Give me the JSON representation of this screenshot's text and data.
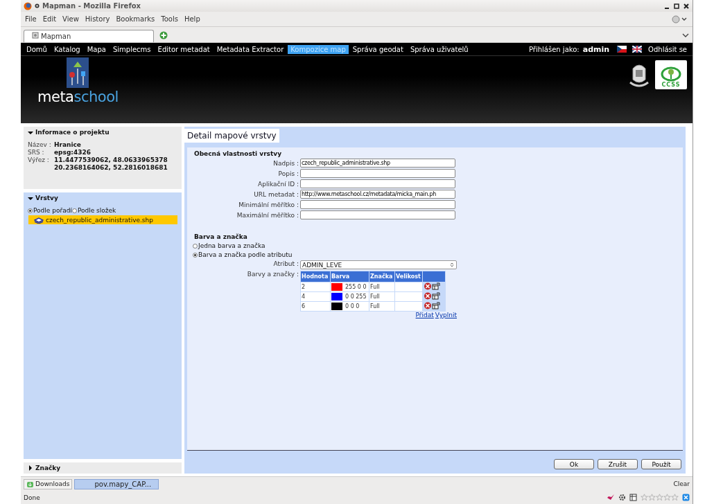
{
  "window": {
    "title": "Mapman - Mozilla Firefox"
  },
  "menu": [
    "File",
    "Edit",
    "View",
    "History",
    "Bookmarks",
    "Tools",
    "Help"
  ],
  "tabs": [
    {
      "label": "Mapman",
      "selected": true
    }
  ],
  "nav": {
    "items": [
      {
        "label": "Domů",
        "selected": false
      },
      {
        "label": "Katalog",
        "selected": false
      },
      {
        "label": "Mapa",
        "selected": false
      },
      {
        "label": "Simplecms",
        "selected": false
      },
      {
        "label": "Editor metadat",
        "selected": false
      },
      {
        "label": "Metadata Extractor",
        "selected": false
      },
      {
        "label": "Kompozice map",
        "selected": true
      },
      {
        "label": "Správa geodat",
        "selected": false
      },
      {
        "label": "Správa uživatelů",
        "selected": false
      }
    ],
    "login_label": "Přihlášen jako:",
    "user": "admin",
    "logout": "Odhlásit se"
  },
  "banner": {
    "logo_first": "meta",
    "logo_second": "school",
    "partner_logo": "CCSS"
  },
  "sidebar": {
    "panels": [
      {
        "kind": "info",
        "title": "Informace o projektu",
        "expanded": true,
        "fields": [
          {
            "label": "Název :",
            "lines": [
              "Hranice"
            ]
          },
          {
            "label": "SRS :",
            "lines": [
              "epsg:4326"
            ]
          },
          {
            "label": "Výřez :",
            "lines": [
              "11.4477539062, 48.0633965378",
              "20.2368164062, 52.2816018681"
            ]
          }
        ]
      },
      {
        "kind": "layers",
        "title": "Vrstvy",
        "expanded": true,
        "modes": [
          {
            "label": "Podle pořadí",
            "selected": true
          },
          {
            "label": "Podle složek",
            "selected": false
          }
        ],
        "layers": [
          {
            "name": "czech_republic_administrative.shp",
            "selected": true
          }
        ]
      },
      {
        "kind": "collapsed",
        "title": "Značky",
        "expanded": false
      }
    ]
  },
  "detail": {
    "title": "Detail mapové vrstvy",
    "general": {
      "heading": "Obecná vlastnosti vrstvy",
      "fields": [
        {
          "label": "Nadpis :",
          "value": "czech_republic_administrative.shp"
        },
        {
          "label": "Popis :"
        },
        {
          "label": "Aplikační ID :"
        },
        {
          "label": "URL metadat :",
          "value": "http://www.metaschool.cz/metadata/micka_main.ph"
        },
        {
          "label": "Minimální měřítko :"
        },
        {
          "label": "Maximální měřítko :"
        }
      ]
    },
    "style": {
      "heading": "Barva a značka",
      "options": [
        {
          "label": "Jedna barva a značka",
          "selected": false
        },
        {
          "label": "Barva a značka podle atributu",
          "selected": true
        }
      ],
      "attribute_label": "Atribut :",
      "attribute_value": "ADMIN_LEVE",
      "table_label": "Barvy a značky :",
      "columns": [
        "Hodnota",
        "Barva",
        "Značka",
        "Velikost"
      ],
      "rows": [
        {
          "value": "2",
          "color": "#ff0000",
          "rgb": "255 0 0",
          "symbol": "Full"
        },
        {
          "value": "4",
          "color": "#0000ff",
          "rgb": "0 0 255",
          "symbol": "Full"
        },
        {
          "value": "6",
          "color": "#000000",
          "rgb": "0 0 0",
          "symbol": "Full"
        }
      ],
      "links": [
        "Přidat",
        "Vyplnit"
      ]
    },
    "buttons": [
      "Ok",
      "Zrušit",
      "Použít"
    ]
  },
  "status_bar": {
    "downloads": "Downloads",
    "task": "pov.mapy_CAP...",
    "clear": "Clear",
    "status": "Done",
    "stars": 0
  }
}
